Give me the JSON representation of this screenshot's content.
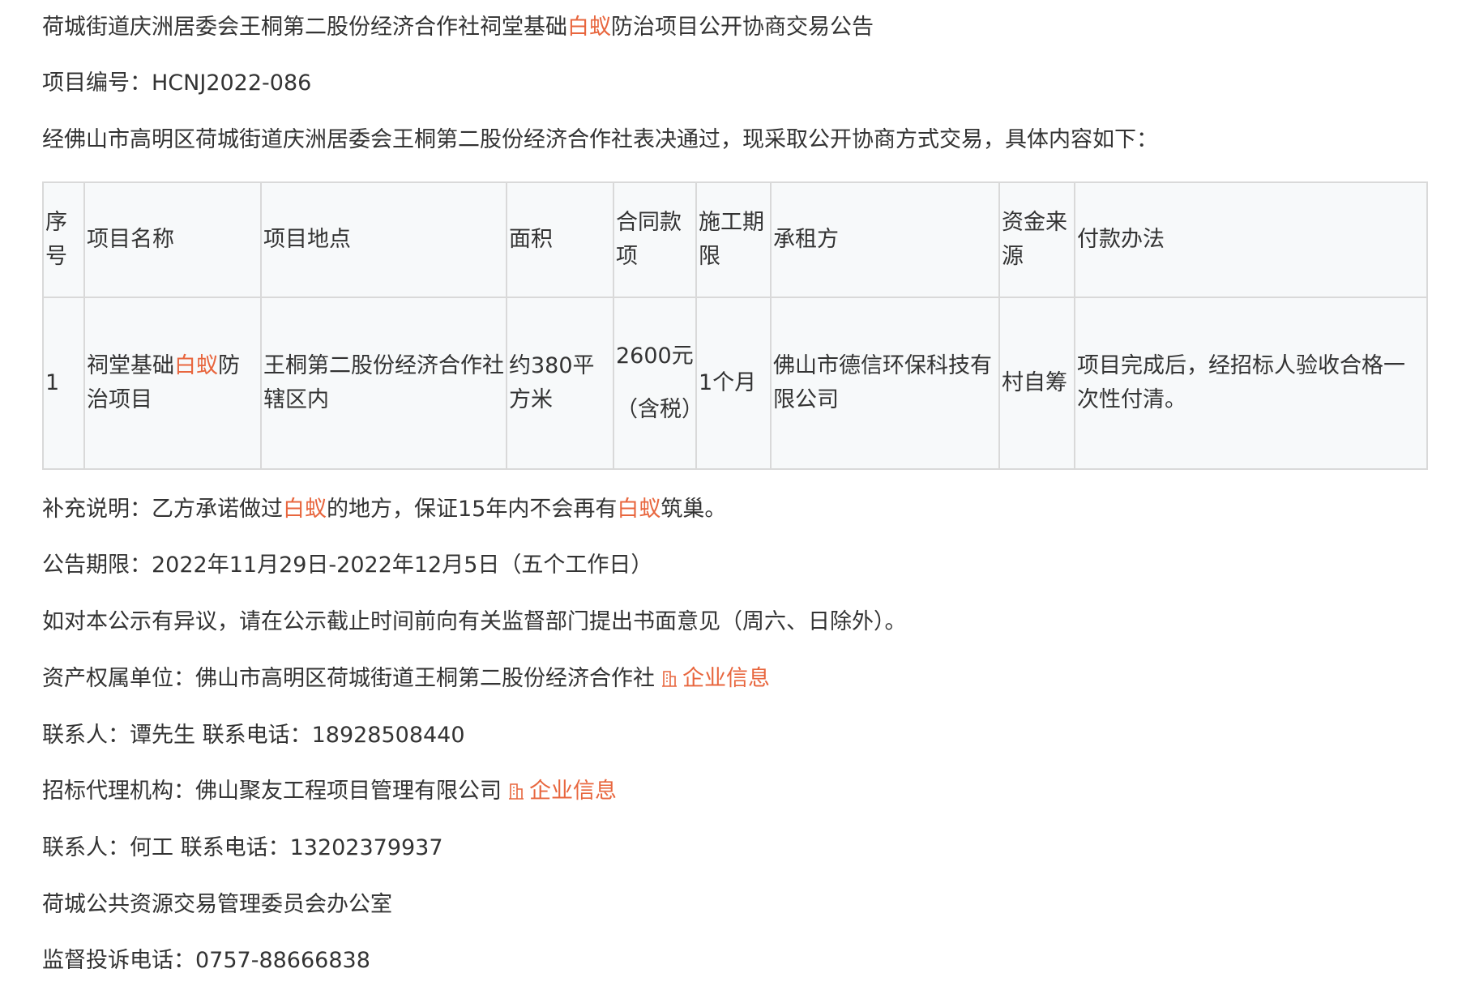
{
  "notice": {
    "title_pre": "荷城街道庆洲居委会王桐第二股份经济合作社祠堂基础",
    "title_hl": "白蚁",
    "title_post": "防治项目公开协商交易公告",
    "project_no_label": "项目编号：",
    "project_no": "HCNJ2022-086",
    "intro": "经佛山市高明区荷城街道庆洲居委会王桐第二股份经济合作社表决通过，现采取公开协商方式交易，具体内容如下："
  },
  "table": {
    "headers": [
      "序号",
      "项目名称",
      "项目地点",
      "面积",
      "合同款项",
      "施工期限",
      "承租方",
      "资金来源",
      "付款办法"
    ],
    "row": {
      "no": "1",
      "name_pre": "祠堂基础",
      "name_hl": "白蚁",
      "name_post": "防治项目",
      "location": "王桐第二股份经济合作社辖区内",
      "area": "约380平方米",
      "amount": "2600元",
      "amount_note": "（含税）",
      "period": "1个月",
      "lessee": "佛山市德信环保科技有限公司",
      "fund": "村自筹",
      "payment": "项目完成后，经招标人验收合格一次性付清。"
    }
  },
  "supplement": {
    "p1": "补充说明：乙方承诺做过",
    "hl1": "白蚁",
    "p2": "的地方，保证15年内不会再有",
    "hl2": "白蚁",
    "p3": "筑巢。"
  },
  "period": "公告期限：2022年11月29日-2022年12月5日（五个工作日）",
  "objection": "如对本公示有异议，请在公示截止时间前向有关监督部门提出书面意见（周六、日除外）。",
  "owner": {
    "label": "资产权属单位：",
    "name": "佛山市高明区荷城街道王桐第二股份经济合作社",
    "link": "企业信息"
  },
  "contact1": "联系人：谭先生 联系电话：18928508440",
  "agent": {
    "label": "招标代理机构：",
    "name": "佛山聚友工程项目管理有限公司",
    "link": "企业信息"
  },
  "contact2": "联系人：何工 联系电话：13202379937",
  "office": "荷城公共资源交易管理委员会办公室",
  "complaint": "监督投诉电话：0757-88666838",
  "colors": {
    "text": "#333333",
    "highlight": "#e8663e",
    "table_bg": "#f7f9fa",
    "table_border": "#d9d9d9"
  },
  "icons": {
    "company_link": "building-icon"
  }
}
